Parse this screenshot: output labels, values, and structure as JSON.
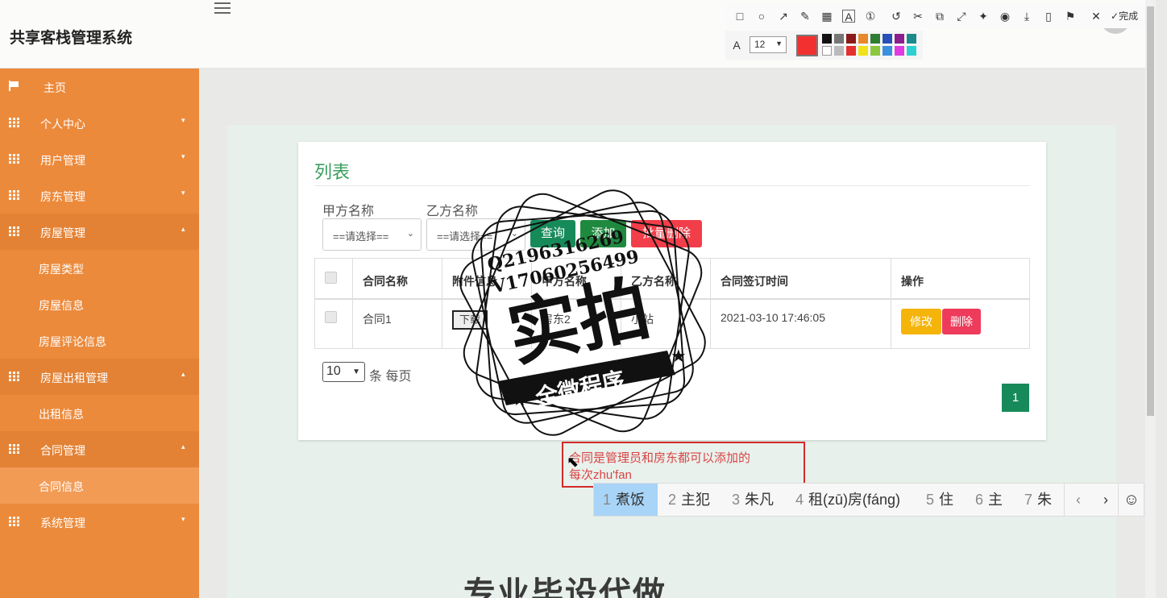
{
  "app": {
    "title": "共享客栈管理系统"
  },
  "sidebar": {
    "items": [
      {
        "label": "主页",
        "icon": "flag-icon"
      },
      {
        "label": "个人中心",
        "icon": "grid-icon",
        "caret": "▾"
      },
      {
        "label": "用户管理",
        "icon": "grid-icon",
        "caret": "▾"
      },
      {
        "label": "房东管理",
        "icon": "grid-icon",
        "caret": "▾"
      },
      {
        "label": "房屋管理",
        "icon": "grid-icon",
        "caret": "▴"
      },
      {
        "label": "房屋类型"
      },
      {
        "label": "房屋信息"
      },
      {
        "label": "房屋评论信息"
      },
      {
        "label": "房屋出租管理",
        "icon": "grid-icon",
        "caret": "▴"
      },
      {
        "label": "出租信息"
      },
      {
        "label": "合同管理",
        "icon": "grid-icon",
        "caret": "▴"
      },
      {
        "label": "合同信息"
      },
      {
        "label": "系统管理",
        "icon": "grid-icon",
        "caret": "▾"
      }
    ]
  },
  "panel": {
    "title": "列表"
  },
  "filters": {
    "party_a_label": "甲方名称",
    "party_a_value": "==请选择==",
    "party_b_label": "乙方名称",
    "party_b_value": "==请选择=="
  },
  "buttons": {
    "search": "查询",
    "add": "添加",
    "batch_delete": "批量删除"
  },
  "table": {
    "headers": [
      "合同名称",
      "附件信息",
      "甲方名称",
      "乙方名称",
      "合同签订时间",
      "操作"
    ],
    "rows": [
      {
        "name": "合同1",
        "attachment": "下载",
        "party_a": "房东2",
        "party_b": "小站",
        "time": "2021-03-10 17:46:05",
        "edit": "修改",
        "delete": "删除"
      }
    ]
  },
  "pagination": {
    "page_size": "10",
    "per_page_text": "条 每页",
    "current_page": "1"
  },
  "watermark": {
    "line1": "Q2196316269",
    "line2": "V17060256499",
    "big": "实拍",
    "banner": "全微程序"
  },
  "note": {
    "line1": "合同是管理员和房东都可以添加的",
    "line2": "每次zhu'fan"
  },
  "ime": {
    "candidates": [
      {
        "n": "1",
        "text": "煮饭"
      },
      {
        "n": "2",
        "text": "主犯"
      },
      {
        "n": "3",
        "text": "朱凡"
      },
      {
        "n": "4",
        "text": "租(zū)房(fáng)"
      },
      {
        "n": "5",
        "text": "住"
      },
      {
        "n": "6",
        "text": "主"
      },
      {
        "n": "7",
        "text": "朱"
      }
    ],
    "prev": "‹",
    "next": "›",
    "emoji": "☺"
  },
  "annot_toolbar": {
    "font_size": "12",
    "done": "完成",
    "color": "#f23030"
  },
  "bottom": {
    "text": "专业毕设代做"
  },
  "colors": {
    "sidebar": "#ec8a3b",
    "accent_green": "#178a5a",
    "danger": "#f23e4a",
    "warning": "#f5b40a"
  }
}
